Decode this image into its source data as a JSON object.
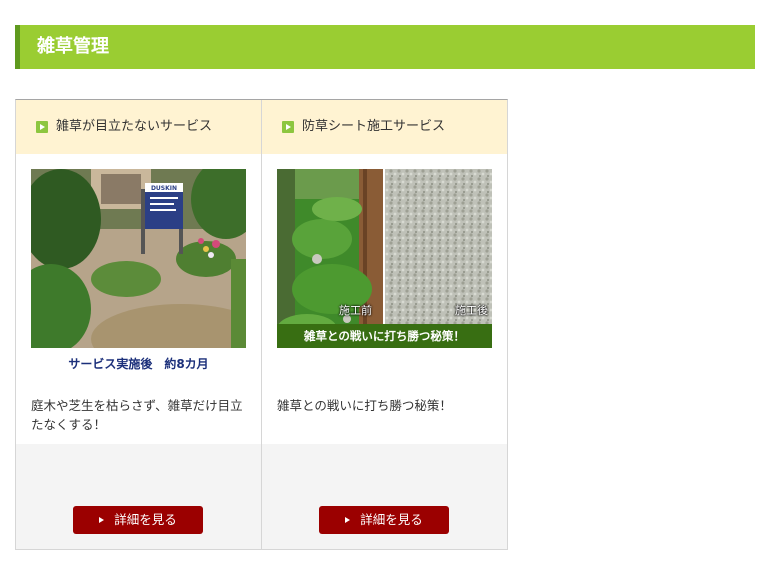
{
  "section": {
    "title": "雑草管理"
  },
  "cards": [
    {
      "title": "雑草が目立たないサービス",
      "caption": "サービス実施後　約8カ月",
      "description": "庭木や芝生を枯らさず、雑草だけ目立たなくする！",
      "sign_text": "DUSKIN",
      "button": "詳細を見る"
    },
    {
      "title": "防草シート施工サービス",
      "before_label": "施工前",
      "after_label": "施工後",
      "banner": "雑草との戦いに打ち勝つ秘策！",
      "description": "雑草との戦いに打ち勝つ秘策！",
      "button": "詳細を見る"
    }
  ],
  "colors": {
    "header_green": "#9acd32",
    "card_head_bg": "#fff3d2",
    "button_red": "#9b0000",
    "caption_blue": "#1b2f7a"
  }
}
